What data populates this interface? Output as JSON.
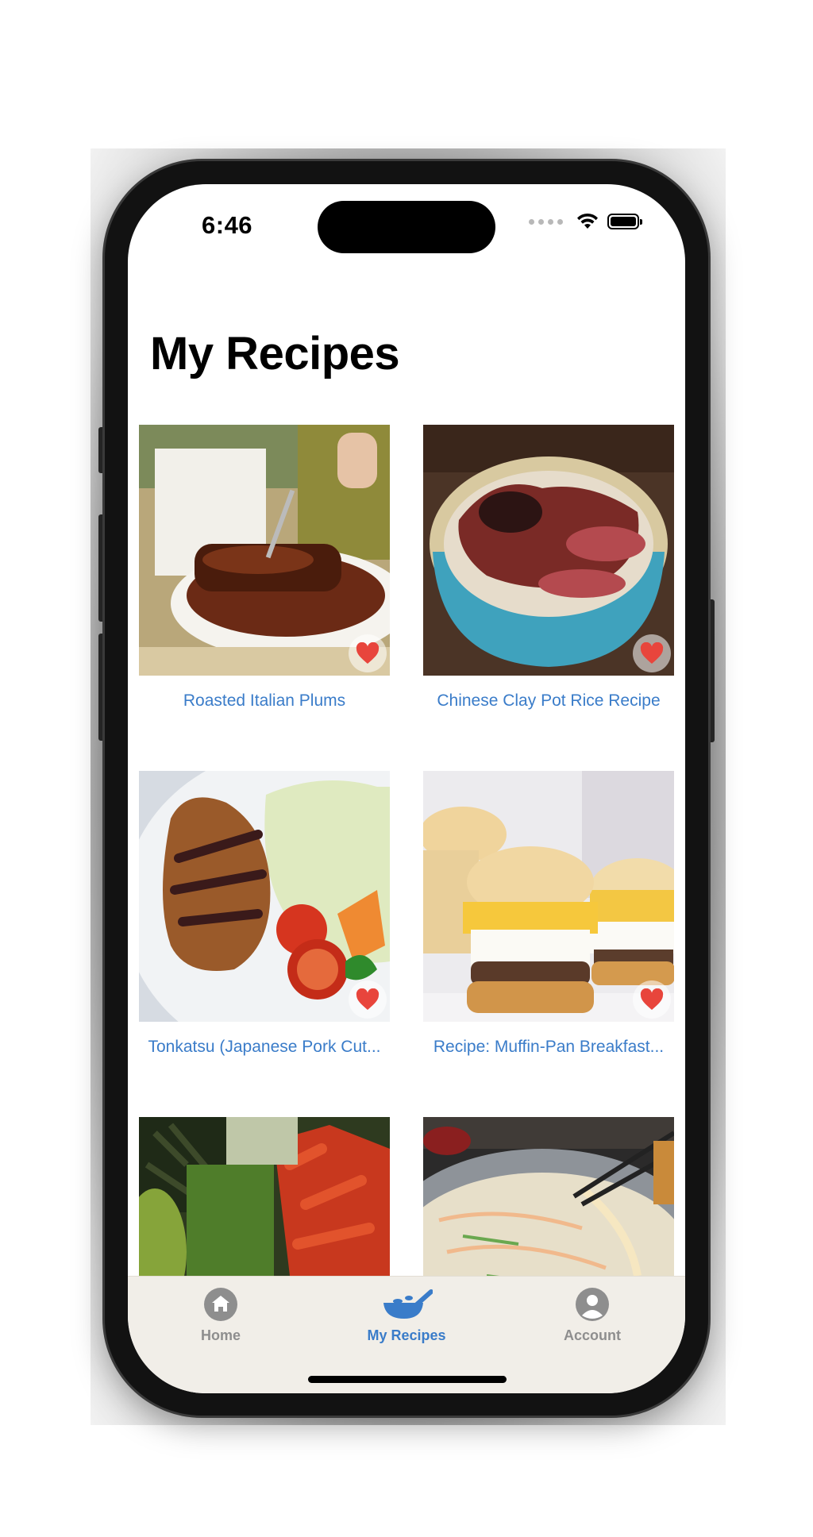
{
  "status_bar": {
    "time": "6:46"
  },
  "header": {
    "title": "My Recipes"
  },
  "recipes": [
    {
      "title": "Roasted Italian Plums",
      "favorite": true
    },
    {
      "title": "Chinese Clay Pot Rice Recipe",
      "favorite": true
    },
    {
      "title": "Tonkatsu (Japanese Pork Cut...",
      "favorite": true
    },
    {
      "title": "Recipe: Muffin-Pan Breakfast...",
      "favorite": true
    },
    {
      "title": "",
      "favorite": false
    },
    {
      "title": "",
      "favorite": false
    }
  ],
  "tabbar": {
    "tabs": [
      {
        "label": "Home",
        "icon": "house-icon",
        "active": false
      },
      {
        "label": "My Recipes",
        "icon": "wok-icon",
        "active": true
      },
      {
        "label": "Account",
        "icon": "person-circle-icon",
        "active": false
      }
    ]
  },
  "colors": {
    "accent": "#3a7cc9",
    "heart": "#e8453c",
    "tab_inactive": "#8e8e8e",
    "tabbar_bg": "#f1eee8"
  }
}
